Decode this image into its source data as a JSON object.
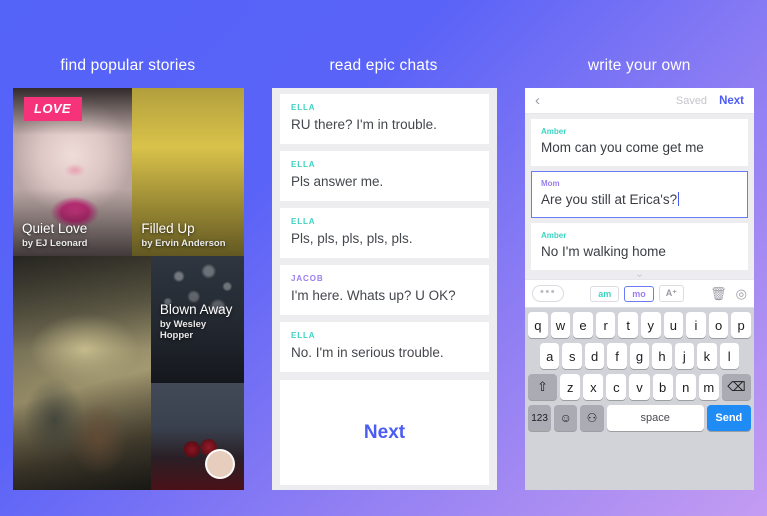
{
  "headings": [
    {
      "text": "find popular stories"
    },
    {
      "text": "read epic chats"
    },
    {
      "text": "write your own"
    }
  ],
  "colors": {
    "bg_start": "#5463f8",
    "bg_end": "#c49cf2",
    "badge_pink": "#f6327a",
    "accent_blue": "#4a5cf4",
    "name_teal": "#3cd3c0",
    "name_purple": "#9b7ef0",
    "send_blue": "#1f8bf5"
  },
  "stories_panel": {
    "badge": "LOVE",
    "tiles": [
      {
        "title": "Quiet Love",
        "author": "by EJ Leonard"
      },
      {
        "title": "Filled Up",
        "author": "by Ervin Anderson"
      },
      {
        "title": "",
        "author": ""
      },
      {
        "title": "Blown Away",
        "author": "by Wesley Hopper"
      },
      {
        "title": "",
        "author": ""
      }
    ]
  },
  "chats_panel": {
    "messages": [
      {
        "name": "ELLA",
        "color": "#3cd3c0",
        "text": "RU there? I'm in trouble."
      },
      {
        "name": "ELLA",
        "color": "#3cd3c0",
        "text": "Pls answer me."
      },
      {
        "name": "ELLA",
        "color": "#3cd3c0",
        "text": "Pls, pls, pls, pls, pls."
      },
      {
        "name": "JACOB",
        "color": "#9b7ef0",
        "text": "I'm here. Whats up? U OK?"
      },
      {
        "name": "ELLA",
        "color": "#3cd3c0",
        "text": "No. I'm in serious trouble."
      }
    ],
    "next_label": "Next"
  },
  "compose_panel": {
    "header": {
      "back_icon": "back-chevron-icon",
      "saved_label": "Saved",
      "next_label": "Next"
    },
    "messages": [
      {
        "name": "Amber",
        "color": "#3cd3c0",
        "text": "Mom can you come get me",
        "active": false
      },
      {
        "name": "Mom",
        "color": "#9b7ef0",
        "text": "Are you still at Erica's?",
        "active": true
      },
      {
        "name": "Amber",
        "color": "#3cd3c0",
        "text": "No I'm walking home",
        "active": false
      }
    ],
    "toolbar": {
      "more_label": "•••",
      "chip_am": "am",
      "chip_mo": "mo",
      "add_person_icon": "A⁺",
      "trash_icon": "🗑",
      "camera_icon": "◎"
    },
    "keyboard": {
      "row1": [
        "q",
        "w",
        "e",
        "r",
        "t",
        "y",
        "u",
        "i",
        "o",
        "p"
      ],
      "row2": [
        "a",
        "s",
        "d",
        "f",
        "g",
        "h",
        "j",
        "k",
        "l"
      ],
      "row3": [
        "z",
        "x",
        "c",
        "v",
        "b",
        "n",
        "m"
      ],
      "shift_icon": "⇧",
      "backspace_icon": "⌫",
      "num_label": "123",
      "emoji_icon": "☺",
      "mic_icon": "⚇",
      "space_label": "space",
      "send_label": "Send"
    }
  }
}
